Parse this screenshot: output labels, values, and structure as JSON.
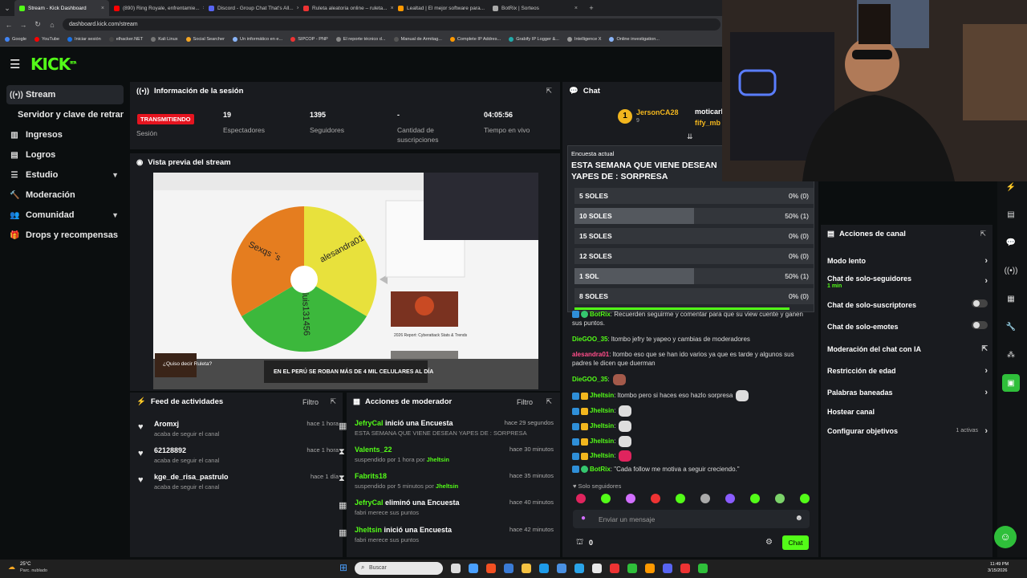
{
  "browser": {
    "tabs": [
      {
        "label": "Stream - Kick Dashboard",
        "color": "#53fc18",
        "active": true
      },
      {
        "label": "(890) Ring Royale, enfrentamie...",
        "color": "#ff0000"
      },
      {
        "label": "Discord - Group Chat That's All...",
        "color": "#5865f2"
      },
      {
        "label": "Ruleta aleatoria online – ruleta...",
        "color": "#e33"
      },
      {
        "label": "Lealtad | El mejor software para...",
        "color": "#f90"
      },
      {
        "label": "BotRix | Sorteos",
        "color": "#aaa"
      }
    ],
    "new_tab": "+",
    "url": "dashboard.kick.com/stream",
    "bookmarks": [
      "Google",
      "YouTube",
      "Iniciar sesión",
      "elhacker.NET",
      "Kali Linux",
      "Social Searcher",
      "Un informático en e...",
      "SIPCOP - PNP",
      "El reporte técnico d...",
      "Manual de Armitag...",
      "Complete IP Addres...",
      "Grabify IP Logger &...",
      "Intelligence X",
      "Online investigation..."
    ]
  },
  "sidebar": {
    "items": [
      {
        "label": "Stream",
        "icon": "stream-icon"
      },
      {
        "label": "Servidor y clave de retransmisión"
      },
      {
        "label": "Ingresos",
        "icon": "revenue-icon"
      },
      {
        "label": "Logros",
        "icon": "achievements-icon"
      },
      {
        "label": "Estudio",
        "icon": "studio-icon"
      },
      {
        "label": "Moderación",
        "icon": "moderation-icon"
      },
      {
        "label": "Comunidad",
        "icon": "community-icon"
      },
      {
        "label": "Drops y recompensas",
        "icon": "drops-icon"
      }
    ]
  },
  "session": {
    "title": "Información de la sesión",
    "live_badge": "TRANSMITIENDO",
    "session_label": "Sesión",
    "viewers": "19",
    "viewers_label": "Espectadores",
    "followers": "1395",
    "followers_label": "Seguidores",
    "subs": "-",
    "subs_label": "Cantidad de suscripciones",
    "uptime": "04:05:56",
    "uptime_label": "Tiempo en vivo"
  },
  "preview": {
    "title": "Vista previa del stream",
    "wheel_labels": [
      "alesandra01",
      "luis131456",
      "Sexqs ˇs"
    ],
    "ad_text": "¿Quiso decir Ruleta?",
    "banner_text": "EN EL PERÚ SE ROBAN MÁS DE 4 MIL CELULARES AL DÍA",
    "card_title": "2026 Report: Cyberattack Stats & Trends"
  },
  "feed": {
    "title": "Feed de actividades",
    "filter": "Filtro",
    "items": [
      {
        "name": "Aromxj",
        "sub": "acaba de seguir el canal",
        "time": "hace 1 hora"
      },
      {
        "name": "62128892",
        "sub": "acaba de seguir el canal",
        "time": "hace 1 hora"
      },
      {
        "name": "kge_de_risa_pastrulo",
        "sub": "acaba de seguir el canal",
        "time": "hace 1 día"
      }
    ]
  },
  "modactions": {
    "title": "Acciones de moderador",
    "filter": "Filtro",
    "items": [
      {
        "user": "JefryCal",
        "action": " inició una Encuesta",
        "sub": "ESTA SEMANA QUE VIENE DESEAN YAPES DE : SORPRESA",
        "by": "",
        "time": "hace 29 segundos",
        "icon": "poll-icon"
      },
      {
        "user": "Valents_22",
        "action": "",
        "sub": "suspendido por 1 hora por ",
        "by": "Jheltsin",
        "time": "hace 30 minutos",
        "icon": "hourglass-icon"
      },
      {
        "user": "Fabrits18",
        "action": "",
        "sub": "suspendido por 5 minutos por ",
        "by": "Jheltsin",
        "time": "hace 35 minutos",
        "icon": "hourglass-icon"
      },
      {
        "user": "JefryCal",
        "action": " eliminó una Encuesta",
        "sub": "fabri merece sus puntos",
        "by": "",
        "time": "hace 40 minutos",
        "icon": "poll-icon"
      },
      {
        "user": "Jheltsin",
        "action": " inició una Encuesta",
        "sub": "fabri merece sus puntos",
        "by": "",
        "time": "hace 42 minutos",
        "icon": "poll-icon"
      }
    ]
  },
  "chat": {
    "title": "Chat",
    "top_gifter": "JersonCA28",
    "top_gifter_count": "9",
    "pinned_users": [
      "moticarl",
      "fify_mb"
    ],
    "poll": {
      "header": "Encuesta actual",
      "question": "ESTA SEMANA QUE VIENE DESEAN YAPES DE : SORPRESA",
      "options": [
        {
          "label": "5 SOLES",
          "pct": 0,
          "value": "0% (0)"
        },
        {
          "label": "10 SOLES",
          "pct": 50,
          "value": "50% (1)"
        },
        {
          "label": "15 SOLES",
          "pct": 0,
          "value": "0% (0)"
        },
        {
          "label": "12 SOLES",
          "pct": 0,
          "value": "0% (0)"
        },
        {
          "label": "1 SOL",
          "pct": 50,
          "value": "50% (1)"
        },
        {
          "label": "8 SOLES",
          "pct": 0,
          "value": "0% (0)"
        }
      ],
      "time_remaining": 0.9
    },
    "messages": [
      {
        "user": "BotRix",
        "color": "#53fc18",
        "text": ": Recuerden seguirme y comentar para que su view cuente y ganen sus puntos."
      },
      {
        "user": "DieGOO_35",
        "color": "#53fc18",
        "text": ": ltombo jefry te yapeo y cambias de moderadores"
      },
      {
        "user": "alesandra01",
        "color": "#ff4d8a",
        "text": ": ltombo eso que se han ido varios ya que es tarde y algunos sus padres le dicen que duerman"
      },
      {
        "user": "DieGOO_35",
        "color": "#53fc18",
        "text": ":"
      },
      {
        "user": "Jheltsin",
        "color": "#53fc18",
        "text": ": ltombo pero si haces eso hazlo sorpresa"
      },
      {
        "user": "Jheltsin",
        "color": "#53fc18",
        "text": ":"
      },
      {
        "user": "Jheltsin",
        "color": "#53fc18",
        "text": ":"
      },
      {
        "user": "Jheltsin",
        "color": "#53fc18",
        "text": ":"
      },
      {
        "user": "Jheltsin",
        "color": "#53fc18",
        "text": ":"
      },
      {
        "user": "BotRix",
        "color": "#53fc18",
        "text": ": \"Cada follow me motiva a seguir creciendo.\""
      }
    ],
    "followers_only": "Solo seguidores",
    "input_placeholder": "Enviar un mensaje",
    "points": "0",
    "send_label": "Chat"
  },
  "channel_actions": {
    "title": "Acciones de canal",
    "items": [
      {
        "label": "Modo lento",
        "ctrl": "chevron"
      },
      {
        "label": "Chat de solo-seguidores",
        "sub": "1 min",
        "ctrl": "chevron"
      },
      {
        "label": "Chat de solo-suscriptores",
        "ctrl": "toggle"
      },
      {
        "label": "Chat de solo-emotes",
        "ctrl": "toggle"
      },
      {
        "label": "Moderación del chat con IA",
        "ctrl": "link"
      },
      {
        "label": "Restricción de edad",
        "ctrl": "chevron"
      },
      {
        "label": "Palabras baneadas",
        "ctrl": "chevron"
      },
      {
        "label": "Hostear canal",
        "ctrl": "none"
      },
      {
        "label": "Configurar objetivos",
        "ctrl": "chevron",
        "extra": "1 activas"
      }
    ]
  },
  "taskbar": {
    "weather_temp": "25°C",
    "weather_desc": "Parc. nublado",
    "search_placeholder": "Buscar",
    "time": "11:49 PM",
    "date": "3/15/2026"
  },
  "colors": {
    "accent": "#53fc18",
    "live": "#e5141f",
    "panel": "#191b1f"
  }
}
